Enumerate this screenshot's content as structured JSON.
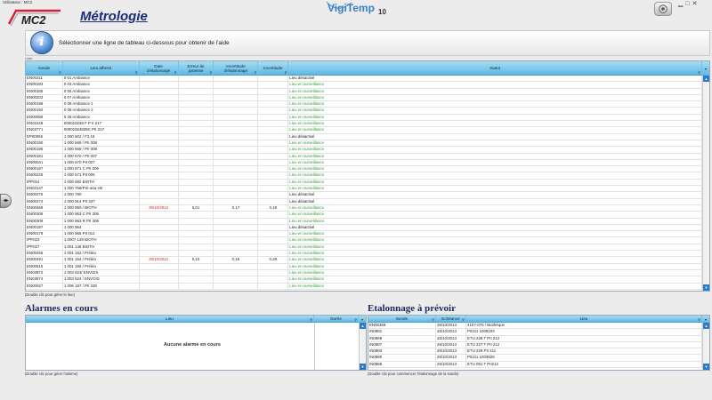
{
  "app": {
    "user_label": "Utilisateur : MC2",
    "logo_text": "MC2",
    "page_title": "Métrologie",
    "brand_main": "VigiTemp",
    "brand_sub": "10",
    "side_handle": "◂▸"
  },
  "help": {
    "text": "Sélectionner une ligne de tableau ci-dessous pour obtenir de l'aide"
  },
  "main_grid": {
    "small_label": "Liste",
    "columns": [
      "Sonde",
      "Lieu affecté",
      "Date d'étalonnage",
      "Erreur de justesse",
      "Incertitude d'étalonnage",
      "Incertitude",
      "Statut"
    ],
    "caption": "(Double clic pour gérer le lieu)",
    "rows": [
      [
        "EN00211",
        "0 01 Ambiance",
        "",
        "",
        "",
        "",
        "Lieu désactivé"
      ],
      [
        "EN00183",
        "0 03 Ambiance",
        "",
        "",
        "",
        "",
        "Lieu en surveillance"
      ],
      [
        "EN00185",
        "0 06 Ambiance",
        "",
        "",
        "",
        "",
        "Lieu en surveillance"
      ],
      [
        "EN00203",
        "0 07 Ambiance",
        "",
        "",
        "",
        "",
        "Lieu en surveillance"
      ],
      [
        "EN00199",
        "0 08 Ambiance 1",
        "",
        "",
        "",
        "",
        "Lieu en surveillance"
      ],
      [
        "EN00192",
        "0 08 Ambiance 2",
        "",
        "",
        "",
        "",
        "Lieu en surveillance"
      ],
      [
        "EN00059",
        "0 28 Ambiance",
        "",
        "",
        "",
        "",
        "Lieu en surveillance"
      ],
      [
        "EN02248",
        "000010248 F P II 217",
        "",
        "",
        "",
        "",
        "Lieu en surveillance"
      ],
      [
        "EN03771",
        "00001024839C PII 217",
        "",
        "",
        "",
        "",
        "Lieu en surveillance"
      ],
      [
        "EP00065",
        "1 000 602 / F3,19",
        "",
        "",
        "",
        "",
        "Lieu désactivé"
      ],
      [
        "EN00190",
        "1 000 669 / PII 008",
        "",
        "",
        "",
        "",
        "Lieu en surveillance"
      ],
      [
        "EN00196",
        "1 000 669 / PII 008",
        "",
        "",
        "",
        "",
        "Lieu en surveillance"
      ],
      [
        "EN00191",
        "1 000 670 / PII 007",
        "",
        "",
        "",
        "",
        "Lieu en surveillance"
      ],
      [
        "EN00041",
        "1 000 670 PII 007",
        "",
        "",
        "",
        "",
        "Lieu en surveillance"
      ],
      [
        "EN00197",
        "1 000 671 C PII 006",
        "",
        "",
        "",
        "",
        "Lieu en surveillance"
      ],
      [
        "EN00225",
        "1 000 671 PII 006",
        "",
        "",
        "",
        "",
        "Lieu en surveillance"
      ],
      [
        "IPP024",
        "1 000 682 BIOTH",
        "",
        "",
        "",
        "",
        "Lieu en surveillance"
      ],
      [
        "EN03147",
        "1 000 758/Pré-ana H0",
        "",
        "",
        "",
        "",
        "Lieu en surveillance"
      ],
      [
        "EN00275",
        "1 000 790",
        "",
        "",
        "",
        "",
        "Lieu désactivé"
      ],
      [
        "EN00274",
        "1 000 914 PII 337",
        "",
        "",
        "",
        "",
        "Lieu désactivé"
      ],
      [
        "EN00469",
        "1 000 950 / BIOTH",
        "30/10/2012",
        "0,01",
        "0,17",
        "0,18",
        "Lieu en surveillance"
      ],
      [
        "EN00308",
        "1 000 963 C PII 306",
        "",
        "",
        "",
        "",
        "Lieu en surveillance"
      ],
      [
        "EN00309",
        "1 000 963 R PII 306",
        "",
        "",
        "",
        "",
        "Lieu en surveillance"
      ],
      [
        "EN00187",
        "1 000 964",
        "",
        "",
        "",
        "",
        "Lieu désactivé"
      ],
      [
        "EN00179",
        "1 000 965 PII 012",
        "",
        "",
        "",
        "",
        "Lieu en surveillance"
      ],
      [
        "IPP023",
        "1 0007 129 BIOTH",
        "",
        "",
        "",
        "",
        "Lieu en surveillance"
      ],
      [
        "IPP027",
        "1 001 148 BIOTH",
        "",
        "",
        "",
        "",
        "Lieu en surveillance"
      ],
      [
        "EN00255",
        "1 001 152 / Préléa",
        "",
        "",
        "",
        "",
        "Lieu en surveillance"
      ],
      [
        "EN00491",
        "1 001 164 / Préléa",
        "30/10/2012",
        "0,10",
        "0,16",
        "0,26",
        "Lieu en surveillance"
      ],
      [
        "EN00515",
        "1 001 165 / Préléa",
        "",
        "",
        "",
        "",
        "Lieu en surveillance"
      ],
      [
        "EN03872",
        "1 003 623/ ENVOIS",
        "",
        "",
        "",
        "",
        "Lieu en surveillance"
      ],
      [
        "EN03874",
        "1 003 624 / ENVOIS",
        "",
        "",
        "",
        "",
        "Lieu en surveillance"
      ],
      [
        "EN00027",
        "1 006 187 / PII 330",
        "",
        "",
        "",
        "",
        "Lieu en surveillance"
      ]
    ]
  },
  "alarms": {
    "title": "Alarmes en cours",
    "columns": [
      "Lieu",
      "Durée"
    ],
    "empty_text": "Aucune alarme en cours",
    "caption": "(Double clic pour gérer l'alarme)"
  },
  "calibration": {
    "title": "Etalonnage à prévoir",
    "columns": [
      "Sonde",
      "Echéance",
      "Lieu"
    ],
    "caption": "(Double clic pour commencer l'étalonnage de la sonde)",
    "rows": [
      [
        "EN00358",
        "26/10/2013",
        "4107-075 / Biothèque"
      ],
      [
        "IN0881",
        "26/10/2013",
        "PII211 1008193"
      ],
      [
        "IN0888",
        "26/10/2013",
        "ETU 228 T PII 212"
      ],
      [
        "IN0887",
        "26/10/2013",
        "ETU 227 T PII 212"
      ],
      [
        "IN0883",
        "26/10/2013",
        "ETU 229 PII 211"
      ],
      [
        "IN0880",
        "26/10/2013",
        "PII211 1003826"
      ],
      [
        "IN0886",
        "26/10/2013",
        "ETU 051 T PII212"
      ]
    ]
  },
  "colors": {
    "accent": "#1a2b7a",
    "header": "#5eb8e3",
    "status_active": "#2f9a2f",
    "date_red": "#cc1f1f"
  }
}
